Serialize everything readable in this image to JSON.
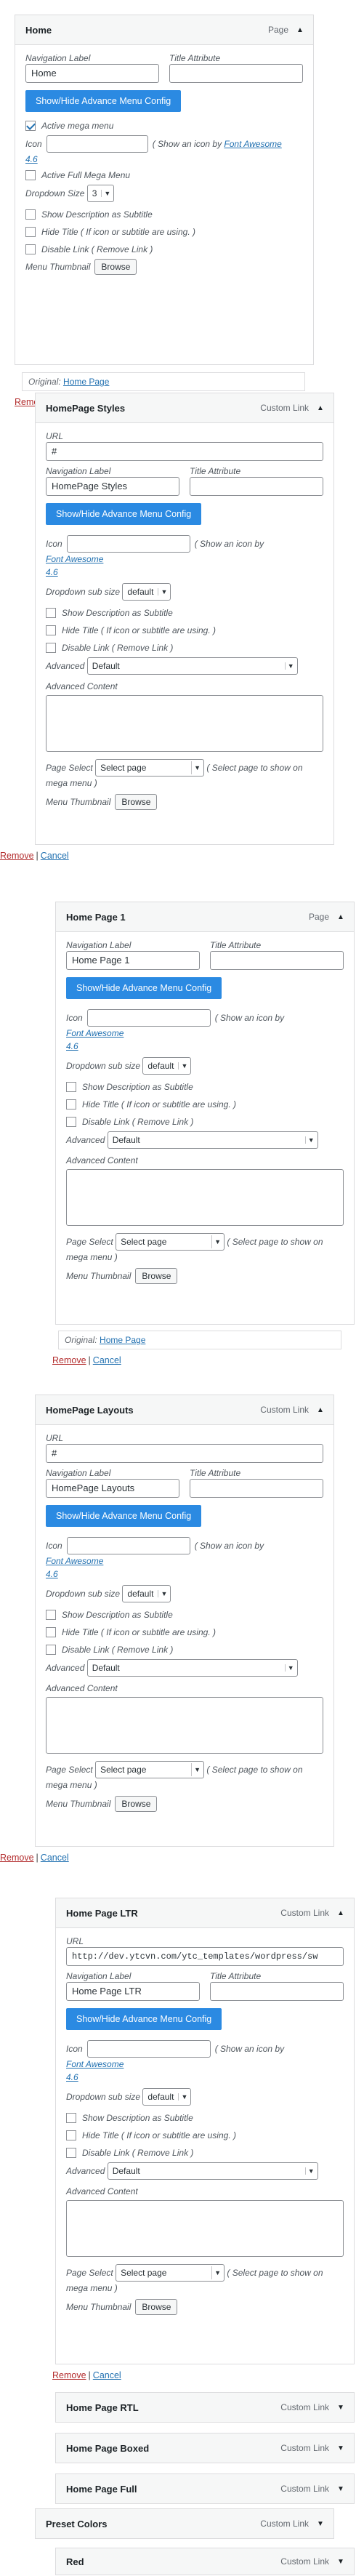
{
  "common": {
    "nav_label": "Navigation Label",
    "title_attr": "Title Attribute",
    "url_label": "URL",
    "show_hide_btn": "Show/Hide Advance Menu Config",
    "icon_label": "Icon",
    "icon_hint_pre": "( Show an icon by",
    "icon_hint_link": "Font Awesome",
    "icon_hint_ver": "4.6",
    "icon_hint_post": ")",
    "active_mega": "Active mega menu",
    "active_full_mega": "Active Full Mega Menu",
    "dropdown_size": "Dropdown Size",
    "dropdown_size_value": "3",
    "dropdown_sub_size": "Dropdown sub size",
    "dropdown_sub_value": "default",
    "show_desc": "Show Description as Subtitle",
    "hide_title": "Hide Title ( If icon or subtitle are using. )",
    "disable_link": "Disable Link ( Remove Link )",
    "advanced": "Advanced",
    "advanced_value": "Default",
    "advanced_content": "Advanced Content",
    "page_select": "Page Select",
    "page_select_value": "Select page",
    "page_select_hint_1": "( Select page to show on",
    "page_select_hint_2": "mega menu )",
    "menu_thumbnail": "Menu Thumbnail",
    "browse": "Browse",
    "original": "Original:",
    "remove": "Remove",
    "cancel": "Cancel",
    "sep": "|"
  },
  "items": {
    "home": {
      "title": "Home",
      "type": "Page",
      "arrow": "▲",
      "nav_value": "Home",
      "original_link": "Home Page"
    },
    "homepage_styles": {
      "title": "HomePage Styles",
      "type": "Custom Link",
      "arrow": "▲",
      "url": "#",
      "nav_value": "HomePage Styles"
    },
    "home_page_1": {
      "title": "Home Page 1",
      "type": "Page",
      "arrow": "▲",
      "nav_value": "Home Page 1",
      "original_link": "Home Page"
    },
    "homepage_layouts": {
      "title": "HomePage Layouts",
      "type": "Custom Link",
      "arrow": "▲",
      "url": "#",
      "nav_value": "HomePage Layouts"
    },
    "home_page_ltr": {
      "title": "Home Page LTR",
      "type": "Custom Link",
      "arrow": "▲",
      "url": "http://dev.ytcvn.com/ytc_templates/wordpress/sw",
      "nav_value": "Home Page LTR"
    },
    "home_page_rtl": {
      "title": "Home Page RTL",
      "type": "Custom Link",
      "arrow": "▼"
    },
    "home_page_boxed": {
      "title": "Home Page Boxed",
      "type": "Custom Link",
      "arrow": "▼"
    },
    "home_page_full": {
      "title": "Home Page Full",
      "type": "Custom Link",
      "arrow": "▼"
    },
    "preset_colors": {
      "title": "Preset Colors",
      "type": "Custom Link",
      "arrow": "▼"
    },
    "red": {
      "title": "Red",
      "type": "Custom Link",
      "arrow": "▼"
    }
  }
}
